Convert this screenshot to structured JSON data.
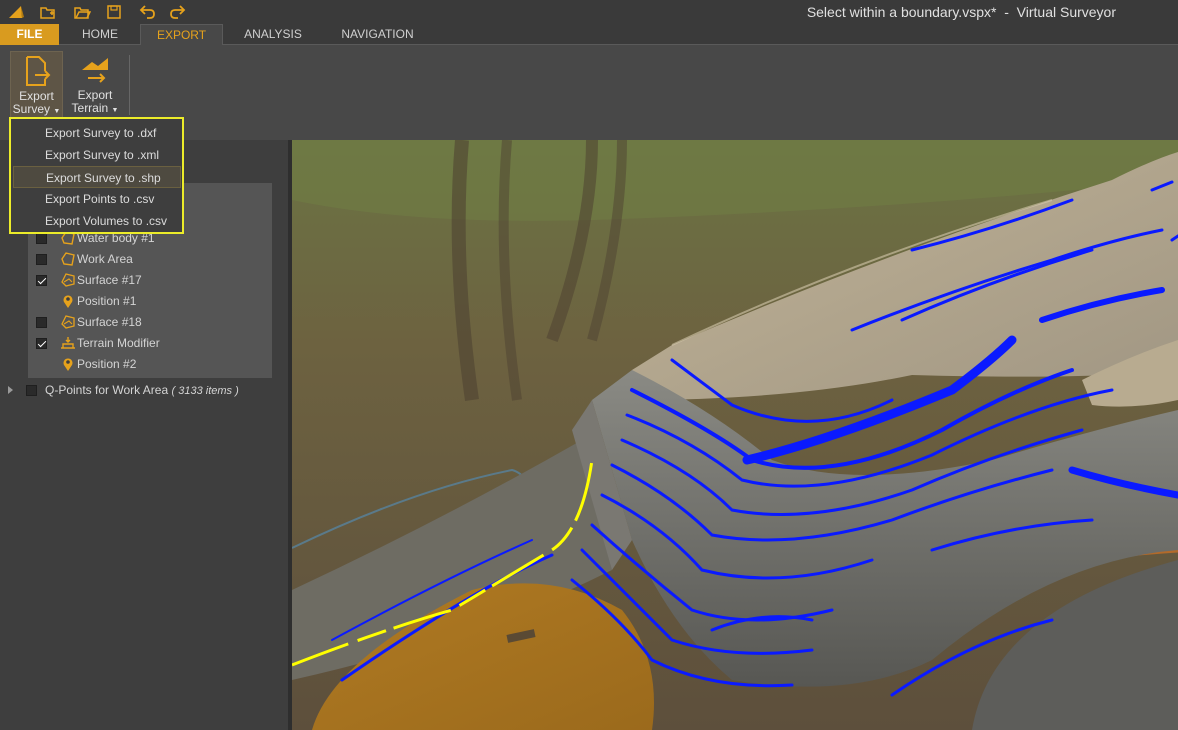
{
  "window": {
    "title": "Select within a boundary.vspx*  -  Virtual Surveyor"
  },
  "quick_access": [
    "app-logo-icon",
    "new-project-icon",
    "open-folder-icon",
    "save-icon",
    "undo-icon",
    "redo-icon"
  ],
  "tabs": {
    "file": "FILE",
    "home": "HOME",
    "export": "EXPORT",
    "analysis": "ANALYSIS",
    "navigation": "NAVIGATION"
  },
  "ribbon": {
    "export_survey": {
      "line1": "Export",
      "line2": "Survey"
    },
    "export_terrain": {
      "line1": "Export",
      "line2": "Terrain"
    }
  },
  "export_menu": {
    "items": [
      "Export Survey to .dxf",
      "Export Survey to .xml",
      "Export Survey to .shp",
      "Export Points to .csv",
      "Export Volumes to .csv"
    ],
    "highlighted_index": 2
  },
  "layers": [
    {
      "label": "Water body #1",
      "checkbox": true,
      "checked": false,
      "icon": "polygon-icon"
    },
    {
      "label": "Work Area",
      "checkbox": true,
      "checked": false,
      "icon": "polygon-icon"
    },
    {
      "label": "Surface #17",
      "checkbox": true,
      "checked": true,
      "icon": "surface-icon"
    },
    {
      "label": "Position #1",
      "checkbox": false,
      "checked": false,
      "icon": "position-pin-icon"
    },
    {
      "label": "Surface #18",
      "checkbox": true,
      "checked": false,
      "icon": "surface-icon"
    },
    {
      "label": "Terrain Modifier",
      "checkbox": true,
      "checked": true,
      "icon": "terrain-modifier-icon"
    },
    {
      "label": "Position #2",
      "checkbox": false,
      "checked": false,
      "icon": "position-pin-icon"
    }
  ],
  "qpoints": {
    "label": "Q-Points for Work Area",
    "count": "( 3133 items )"
  },
  "colors": {
    "accent": "#e6a21c",
    "file_tab": "#d99b1f",
    "highlight_box": "#ecec2a",
    "contour": "#0a1aff",
    "boundary": "#ffff00"
  }
}
